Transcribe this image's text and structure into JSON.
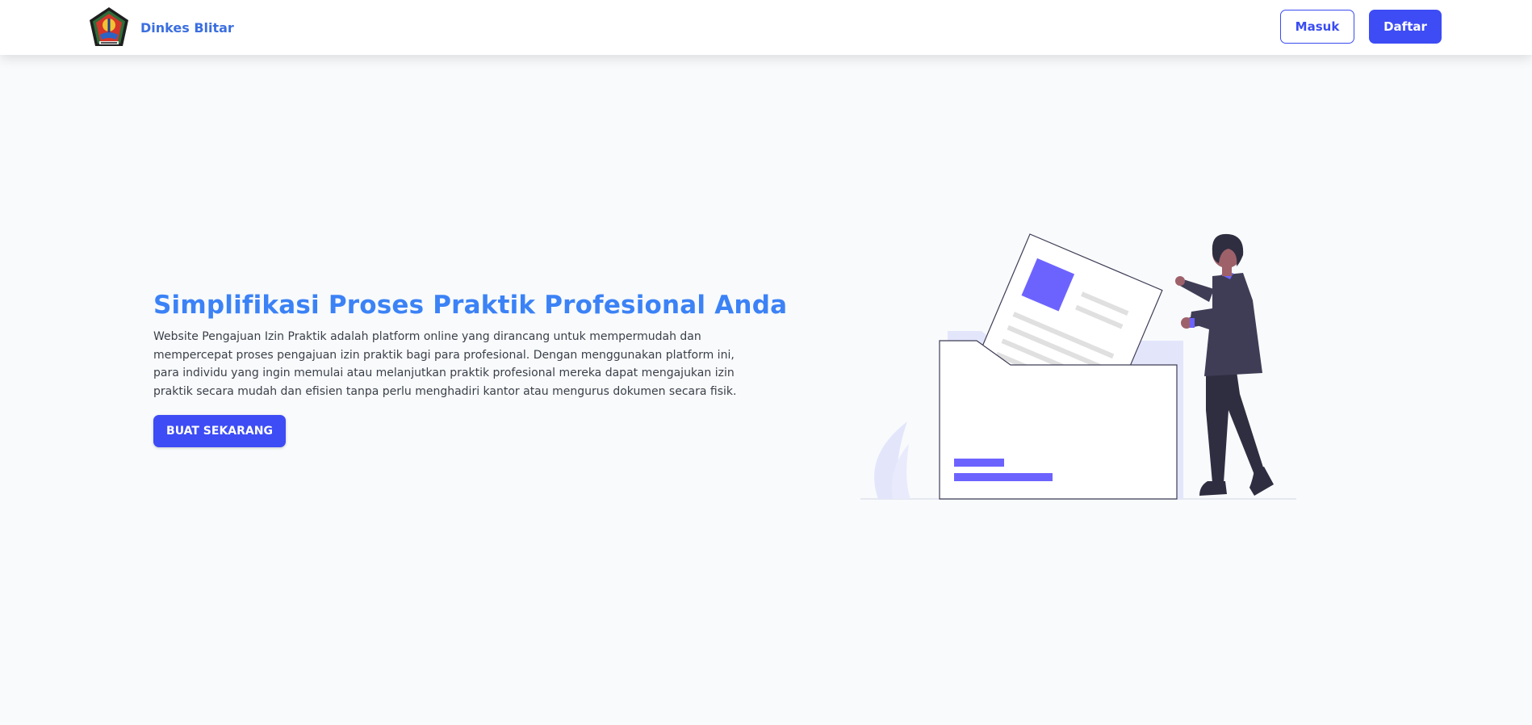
{
  "navbar": {
    "brand_name": "Dinkes Blitar",
    "login_label": "Masuk",
    "register_label": "Daftar"
  },
  "hero": {
    "title": "Simplifikasi Proses Praktik Profesional Anda",
    "description": "Website Pengajuan Izin Praktik adalah platform online yang dirancang untuk mempermudah dan mempercepat proses pengajuan izin praktik bagi para profesional. Dengan menggunakan platform ini, para individu yang ingin memulai atau melanjutkan praktik profesional mereka dapat mengajukan izin praktik secara mudah dan efisien tanpa perlu menghadiri kantor atau mengurus dokumen secara fisik.",
    "cta_label": "BUAT SEKARANG"
  },
  "icons": {
    "logo": "blitar-regency-emblem-icon",
    "illustration": "person-filing-documents-illustration"
  },
  "colors": {
    "primary": "#3d4cf5",
    "title": "#3b82f6",
    "brand": "#3b6fe0",
    "illustration_accent": "#6c63ff",
    "illustration_dark": "#3f3d56"
  }
}
